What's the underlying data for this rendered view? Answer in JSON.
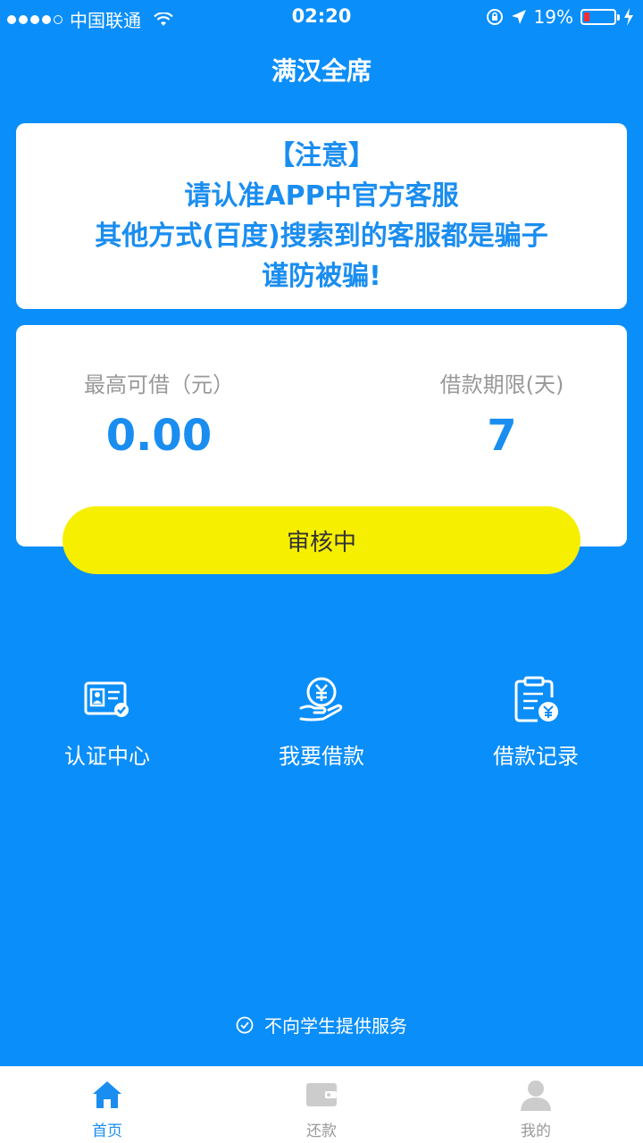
{
  "status_bar": {
    "carrier": "中国联通",
    "time": "02:20",
    "battery": "19%",
    "battery_level": 0.19
  },
  "nav": {
    "title": "满汉全席"
  },
  "notice": {
    "lines": [
      "【注意】",
      "请认准APP中官方客服",
      "其他方式(百度)搜索到的客服都是骗子",
      "谨防被骗!"
    ]
  },
  "loan": {
    "max_label": "最高可借（元）",
    "max_value": "0.00",
    "term_label": "借款期限(天)",
    "term_value": "7",
    "button_label": "审核中"
  },
  "features": [
    {
      "label": "认证中心",
      "icon": "id-card-icon"
    },
    {
      "label": "我要借款",
      "icon": "coin-hand-icon"
    },
    {
      "label": "借款记录",
      "icon": "clipboard-yen-icon"
    }
  ],
  "footer_note": "不向学生提供服务",
  "tabs": [
    {
      "label": "首页",
      "icon": "home-icon",
      "active": true
    },
    {
      "label": "还款",
      "icon": "wallet-icon",
      "active": false
    },
    {
      "label": "我的",
      "icon": "user-icon",
      "active": false
    }
  ],
  "colors": {
    "background": "#0a8ef9",
    "accent": "#1a8df0",
    "button": "#f7ef00"
  }
}
